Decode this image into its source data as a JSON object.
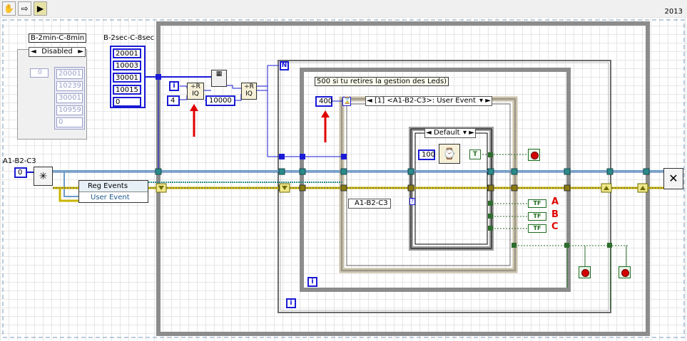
{
  "toolbar": {
    "hand_icon": "hand-icon",
    "arrow_icon": "arrow-icon",
    "step_icon": "highlight-icon",
    "version": "2013"
  },
  "front_panel": {
    "cluster_title": "B-2min-C-8min",
    "ring_value": "Disabled",
    "array_index": "0",
    "array_values": [
      "20001",
      "10239",
      "30001",
      "10959",
      "0"
    ],
    "const_array_label": "B-2sec-C-8sec",
    "const_array_values": [
      "20001",
      "10003",
      "30001",
      "10015",
      "0"
    ]
  },
  "event_ref": {
    "label": "A1-B2-C3",
    "value": "0"
  },
  "reg_events": {
    "title": "Reg Events",
    "item": "User Event"
  },
  "constants": {
    "index_i": "i",
    "divisor_4": "4",
    "divisor_10000": "10000",
    "timeout_400": "400",
    "wait_100": "100",
    "bool_true": "T",
    "loop_n": "N",
    "iter_i": "i"
  },
  "note": "500 si tu retires la gestion des Leds)",
  "event_structure": {
    "case_label": "[1] <A1-B2-C3>: User Event",
    "data_node": "A1-B2-C3"
  },
  "case_structure": {
    "selector": "Default"
  },
  "indicators": {
    "tf_label": "TF",
    "A": "A",
    "B": "B",
    "C": "C"
  },
  "colors": {
    "wire_blue": "#1a1ad6",
    "wire_green": "#2d6d2d",
    "wire_event": "#6c9cc9",
    "wire_refnum": "#2a8a8a",
    "error_wire": "#c8b400",
    "frame": "#808080"
  }
}
